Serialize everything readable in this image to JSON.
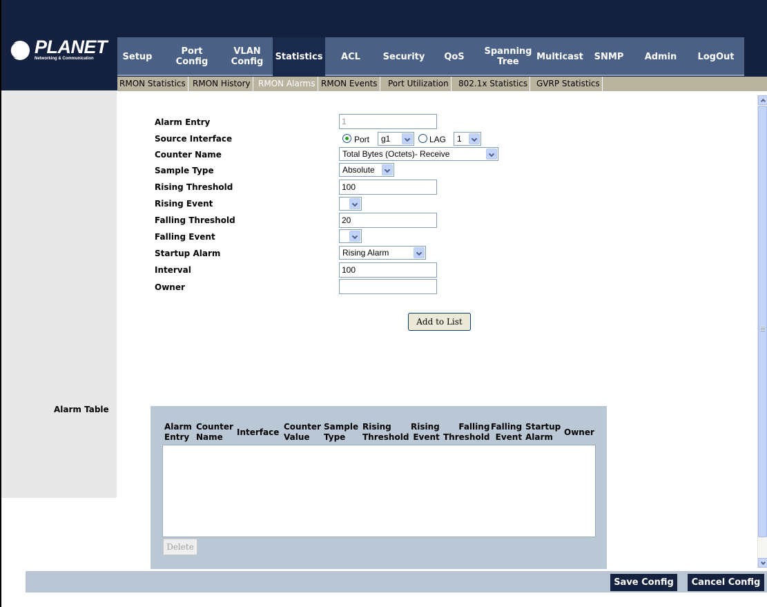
{
  "brand": {
    "name": "PLANET",
    "tagline": "Networking & Communication"
  },
  "nav": {
    "items": [
      {
        "label": "Setup"
      },
      {
        "label": "Port\nConfig"
      },
      {
        "label": "VLAN\nConfig"
      },
      {
        "label": "Statistics",
        "active": true
      },
      {
        "label": "ACL"
      },
      {
        "label": "Security"
      },
      {
        "label": "QoS"
      },
      {
        "label": "Spanning\nTree"
      },
      {
        "label": "Multicast"
      },
      {
        "label": "SNMP"
      },
      {
        "label": "Admin"
      },
      {
        "label": "LogOut"
      }
    ]
  },
  "subnav": {
    "items": [
      {
        "label": "RMON Statistics"
      },
      {
        "label": "RMON History"
      },
      {
        "label": "RMON Alarms",
        "active": true
      },
      {
        "label": "RMON Events"
      },
      {
        "label": "Port Utilization"
      },
      {
        "label": "802.1x Statistics"
      },
      {
        "label": "GVRP Statistics"
      }
    ]
  },
  "form": {
    "labels": {
      "alarm_entry": "Alarm Entry",
      "source_interface": "Source Interface",
      "counter_name": "Counter Name",
      "sample_type": "Sample Type",
      "rising_threshold": "Rising Threshold",
      "rising_event": "Rising Event",
      "falling_threshold": "Falling Threshold",
      "falling_event": "Falling Event",
      "startup_alarm": "Startup Alarm",
      "interval": "Interval",
      "owner": "Owner"
    },
    "values": {
      "alarm_entry": "1",
      "source_port_label": "Port",
      "source_port_value": "g1",
      "source_lag_label": "LAG",
      "source_lag_value": "1",
      "counter_name": "Total Bytes (Octets)- Receive",
      "sample_type": "Absolute",
      "rising_threshold": "100",
      "rising_event": "",
      "falling_threshold": "20",
      "falling_event": "",
      "startup_alarm": "Rising Alarm",
      "interval": "100",
      "owner": ""
    },
    "add_button": "Add to List"
  },
  "alarm_table": {
    "label": "Alarm Table",
    "columns": [
      "Alarm\nEntry",
      "Counter\nName",
      "Interface",
      "Counter\nValue",
      "Sample\nType",
      "Rising\nThreshold",
      "Rising\nEvent",
      "Falling\nThreshold",
      "Falling\nEvent",
      "Startup\nAlarm",
      "Owner"
    ],
    "rows": [],
    "delete_button": "Delete"
  },
  "footer": {
    "save_button": "Save Config",
    "cancel_button": "Cancel Config"
  }
}
